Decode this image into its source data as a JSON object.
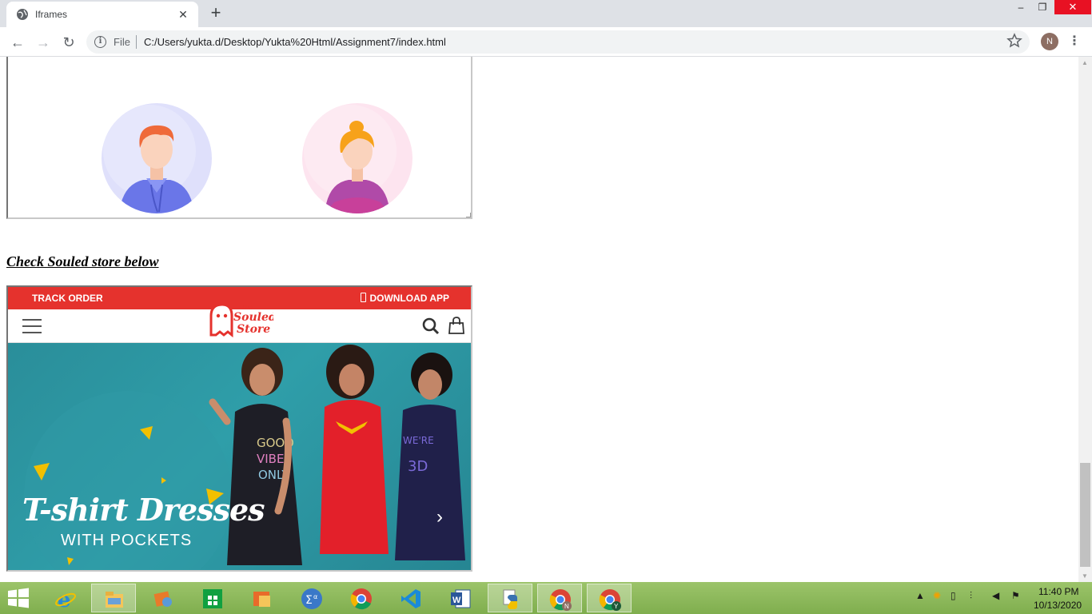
{
  "browser": {
    "tab_title": "Iframes",
    "tab_close": "✕",
    "new_tab": "+",
    "window_controls": {
      "minimize": "–",
      "maximize": "❐",
      "close": "✕"
    },
    "nav": {
      "back": "←",
      "forward": "→",
      "reload": "↻"
    },
    "omnibox": {
      "info": "i",
      "scheme_label": "File",
      "url": "C:/Users/yukta.d/Desktop/Yukta%20Html/Assignment7/index.html"
    },
    "profile_initial": "N",
    "menu": "⋮",
    "bookmark_icon": "star-outline-icon"
  },
  "page": {
    "section_heading": "Check Souled store below",
    "avatars": [
      "male-avatar",
      "female-avatar"
    ],
    "store": {
      "top_bar_left": "TRACK ORDER",
      "top_bar_right": "DOWNLOAD APP",
      "brand": "The Souled Store",
      "banner_title": "T-shirt Dresses",
      "banner_subtitle": "WITH POCKETS",
      "banner_print": "GOOD VIBES ONLY",
      "next": "›",
      "colors": {
        "red": "#e5322d",
        "teal": "#2a8e9a"
      }
    }
  },
  "taskbar": {
    "apps": [
      "start",
      "internet-explorer",
      "file-explorer",
      "media-player",
      "store",
      "office-tool",
      "math-input",
      "chrome",
      "vs-code",
      "word",
      "python",
      "chrome-profile-n",
      "chrome-profile-y"
    ],
    "clock_time": "11:40 PM",
    "clock_date": "10/13/2020",
    "chrome_badges": [
      "N",
      "Y"
    ],
    "accent": "#8ab85a"
  }
}
